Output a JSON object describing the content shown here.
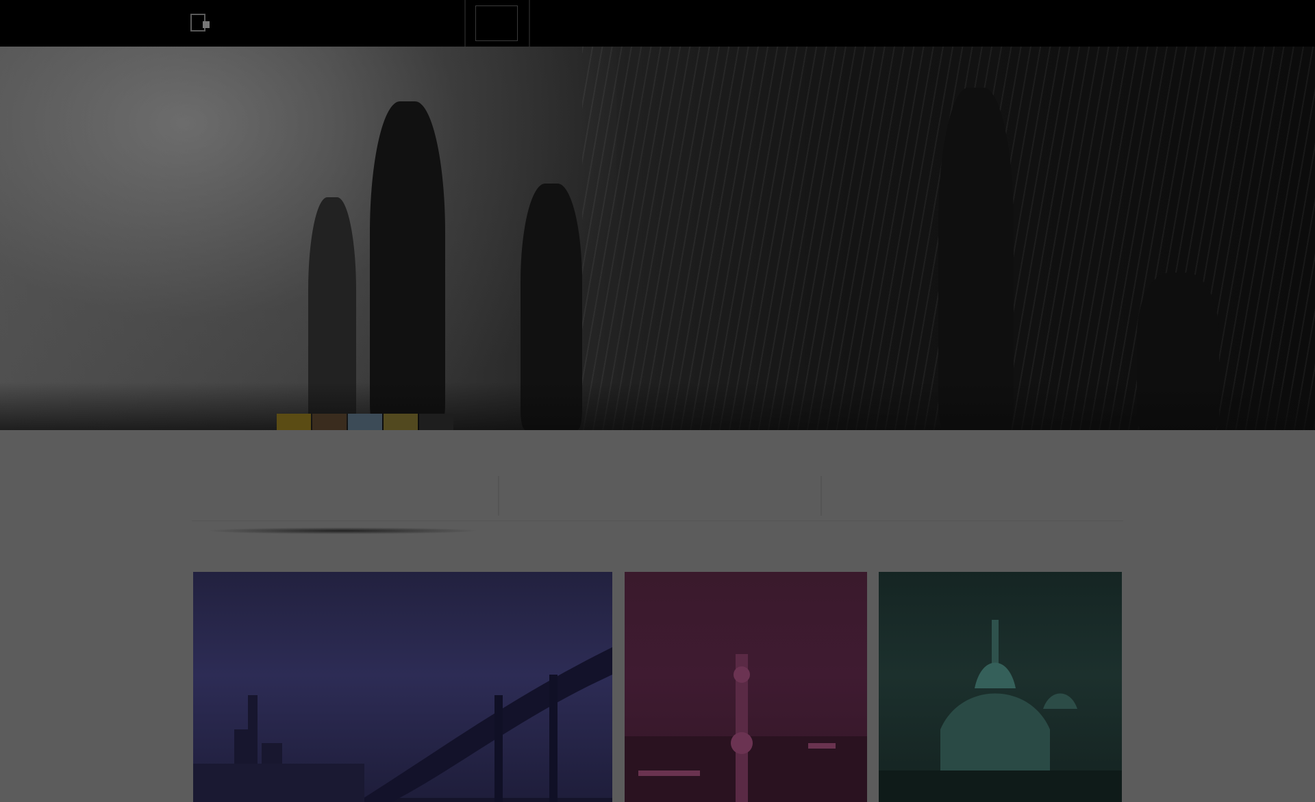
{
  "header": {
    "logo_text": "",
    "nav": {
      "active": "",
      "items": [
        "",
        "",
        "",
        ""
      ],
      "login": ""
    }
  },
  "hero": {
    "thumb_colors": [
      "#5b4c14",
      "#3a2c1e",
      "#3c4b57",
      "#52491f",
      "#1e1e1e"
    ]
  },
  "tabs": [
    {
      "title": "",
      "subtitle": ""
    },
    {
      "title": "",
      "subtitle": ""
    },
    {
      "title": "",
      "subtitle": ""
    }
  ],
  "cards": [
    {
      "subject": "bridge-night",
      "tint": "#2d2c55"
    },
    {
      "subject": "tower-skyline",
      "tint": "#3f1b31"
    },
    {
      "subject": "domed-church",
      "tint": "#1c302d"
    }
  ]
}
